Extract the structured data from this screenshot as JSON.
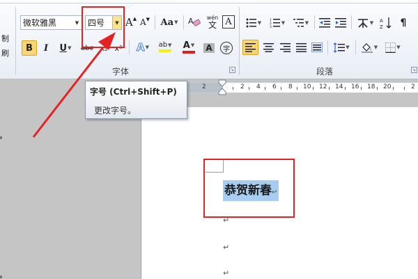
{
  "ribbon": {
    "clipboard_fragments": [
      "制",
      "刷"
    ],
    "font_name": "微软雅黑",
    "font_size": "四号",
    "grow_font_label": "A",
    "shrink_font_label": "A",
    "change_case_label": "Aa",
    "clear_format_label": "や",
    "phonetic_label": "wén",
    "char_border_label": "A",
    "bold_label": "B",
    "italic_label": "I",
    "underline_label": "U",
    "strike_label": "abc",
    "text_effect_label": "A",
    "highlight_label": "ab",
    "font_color_label": "A",
    "char_shading_label": "A",
    "enclose_label": "字",
    "font_group_label": "字体",
    "paragraph_group_label": "段落"
  },
  "tooltip": {
    "title": "字号 (Ctrl+Shift+P)",
    "description": "更改字号。"
  },
  "ruler": {
    "numbers": [
      "2",
      "2",
      "4",
      "6",
      "8",
      "10",
      "12",
      "14",
      "16",
      "18",
      "20",
      "2"
    ]
  },
  "document": {
    "text": "恭贺新春",
    "paragraph_mark": "↵"
  },
  "colors": {
    "annotation_red": "#e52221",
    "selection_blue": "#a7cef0",
    "active_button_gold": "#fbd56f",
    "font_color_red": "#e0201f",
    "highlight_yellow": "#f4f400"
  }
}
